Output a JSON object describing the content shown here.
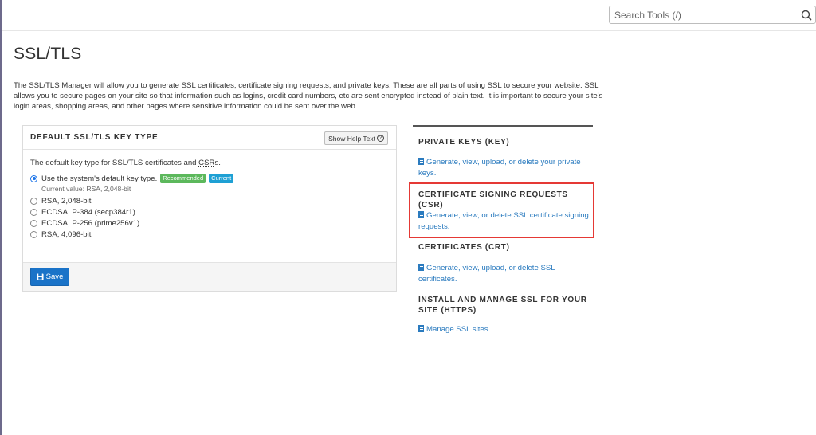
{
  "search": {
    "placeholder": "Search Tools (/)"
  },
  "page": {
    "title": "SSL/TLS",
    "intro": "The SSL/TLS Manager will allow you to generate SSL certificates, certificate signing requests, and private keys. These are all parts of using SSL to secure your website. SSL allows you to secure pages on your site so that information such as logins, credit card numbers, etc are sent encrypted instead of plain text. It is important to secure your site's login areas, shopping areas, and other pages where sensitive information could be sent over the web."
  },
  "panel": {
    "title": "DEFAULT SSL/TLS KEY TYPE",
    "help_label": "Show Help Text",
    "desc_prefix": "The default key type for SSL/TLS certificates and ",
    "desc_abbr": "CSR",
    "desc_suffix": "s.",
    "options": [
      {
        "label": "Use the system's default key type.",
        "selected": true
      },
      {
        "label": "RSA, 2,048-bit",
        "selected": false
      },
      {
        "label": "ECDSA, P-384 (secp384r1)",
        "selected": false
      },
      {
        "label": "ECDSA, P-256 (prime256v1)",
        "selected": false
      },
      {
        "label": "RSA, 4,096-bit",
        "selected": false
      }
    ],
    "badge_recommended": "Recommended",
    "badge_current": "Current",
    "current_value": "Current value: RSA, 2,048-bit",
    "save_label": "Save"
  },
  "sections": [
    {
      "title": "PRIVATE KEYS (KEY)",
      "link": "Generate, view, upload, or delete your private keys."
    },
    {
      "title": "CERTIFICATE SIGNING REQUESTS (CSR)",
      "link": "Generate, view, or delete SSL certificate signing requests."
    },
    {
      "title": "CERTIFICATES (CRT)",
      "link": "Generate, view, upload, or delete SSL certificates."
    },
    {
      "title": "INSTALL AND MANAGE SSL FOR YOUR SITE (HTTPS)",
      "link": "Manage SSL sites."
    }
  ],
  "colors": {
    "link": "#2b7bbf",
    "primary_button": "#1a73c8",
    "highlight": "#e53935",
    "recommended": "#5cb85c",
    "current": "#1ea0d4"
  }
}
